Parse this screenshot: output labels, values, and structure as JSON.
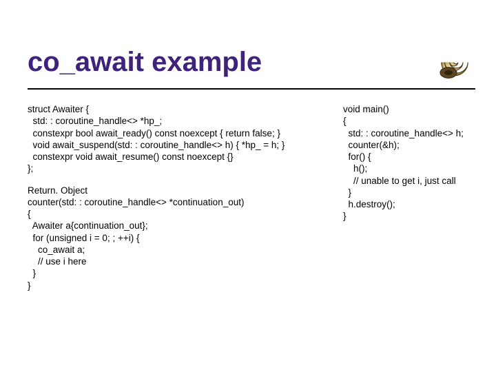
{
  "title": "co_await example",
  "left": {
    "block1": "struct Awaiter {\n  std: : coroutine_handle<> *hp_;\n  constexpr bool await_ready() const noexcept { return false; }\n  void await_suspend(std: : coroutine_handle<> h) { *hp_ = h; }\n  constexpr void await_resume() const noexcept {}\n};",
    "block2": "Return. Object\ncounter(std: : coroutine_handle<> *continuation_out)\n{\n  Awaiter a{continuation_out};\n  for (unsigned i = 0; ; ++i) {\n    co_await a;\n    // use i here\n  }\n}"
  },
  "right": {
    "block1": "void main()\n{\n  std: : coroutine_handle<> h;\n  counter(&h);\n  for() {\n    h();\n    // unable to get i, just call\n  }\n  h.destroy();\n}"
  }
}
